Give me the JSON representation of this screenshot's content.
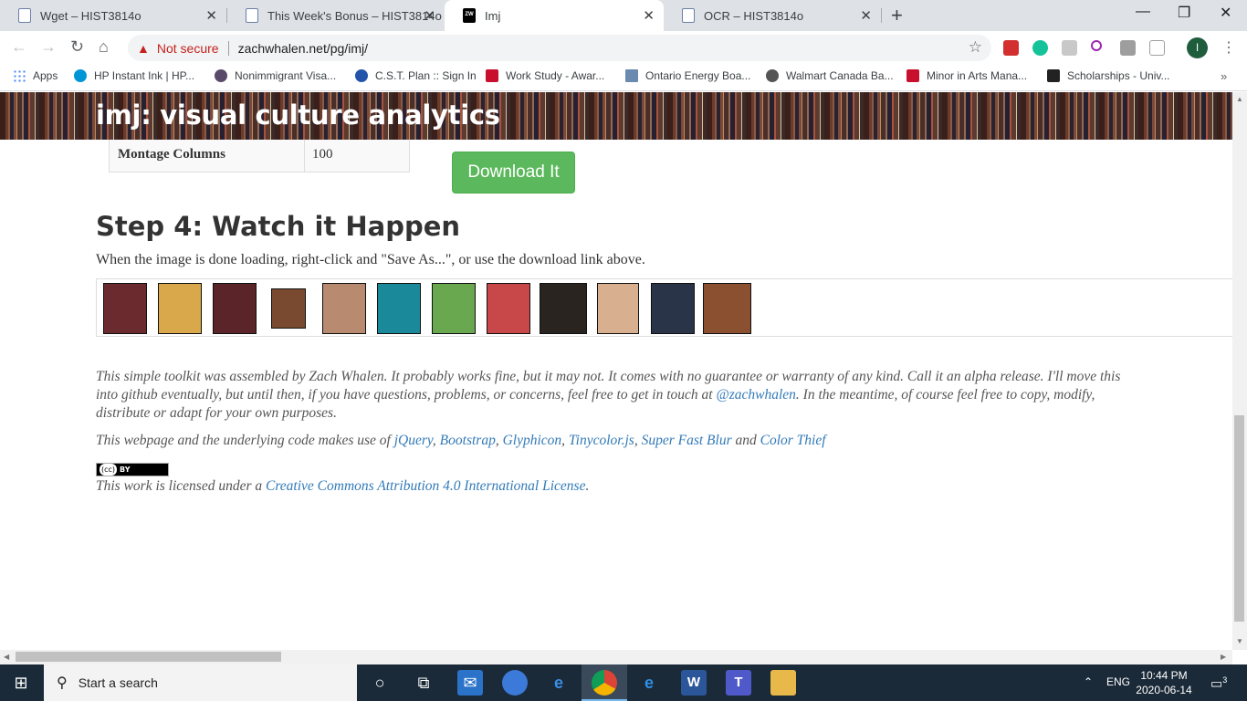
{
  "tabs": [
    {
      "title": "Wget – HIST3814o",
      "icon": "document-icon"
    },
    {
      "title": "This Week's Bonus – HIST3814o",
      "icon": "document-icon"
    },
    {
      "title": "Imj",
      "icon": "zw-favicon",
      "active": true,
      "fav_text": "ZW"
    },
    {
      "title": "OCR – HIST3814o",
      "icon": "document-icon"
    }
  ],
  "toolbar": {
    "not_secure": "Not secure",
    "url": "zachwhalen.net/pg/imj/",
    "profile_initial": "I"
  },
  "bookmarks": [
    {
      "label": "Apps",
      "color": "#4285f4"
    },
    {
      "label": "HP Instant Ink | HP...",
      "color": "#0096d6"
    },
    {
      "label": "Nonimmigrant Visa...",
      "color": "#5a4a6a"
    },
    {
      "label": "C.S.T. Plan :: Sign In",
      "color": "#2255aa"
    },
    {
      "label": "Work Study - Awar...",
      "color": "#c8102e"
    },
    {
      "label": "Ontario Energy Boa...",
      "color": "#6a8ab0"
    },
    {
      "label": "Walmart Canada Ba...",
      "color": "#555555"
    },
    {
      "label": "Minor in Arts Mana...",
      "color": "#c8102e"
    },
    {
      "label": "Scholarships - Univ...",
      "color": "#222222"
    }
  ],
  "page": {
    "banner_title": "imj: visual culture analytics",
    "table": {
      "label": "Montage Columns",
      "value": "100"
    },
    "download_button": "Download It",
    "step_heading": "Step 4: Watch it Happen",
    "step_desc": "When the image is done loading, right-click and \"Save As...\", or use the download link above.",
    "thumbnails": [
      {
        "color": "#6b2a2e"
      },
      {
        "color": "#d8a84a"
      },
      {
        "color": "#5a2428"
      },
      {
        "color": "#7a4a30"
      },
      {
        "color": "#b88a70"
      },
      {
        "color": "#1a8a9a"
      },
      {
        "color": "#6aa850"
      },
      {
        "color": "#c8484a"
      },
      {
        "color": "#2a2420"
      },
      {
        "color": "#d8b090"
      },
      {
        "color": "#2a3448"
      },
      {
        "color": "#8a5030"
      }
    ],
    "footer_p1_a": "This simple toolkit was assembled by Zach Whalen. It probably works fine, but it may not. It comes with no guarantee or warranty of any kind. Call it an alpha release. I'll move this into github eventually, but until then, if you have questions, problems, or concerns, feel free to get in touch at ",
    "footer_p1_link": "@zachwhalen",
    "footer_p1_b": ". In the meantime, of course feel free to copy, modify, distribute or adapt for your own purposes.",
    "footer_p2_a": "This webpage and the underlying code makes use of ",
    "libs": [
      "jQuery",
      "Bootstrap",
      "Glyphicon",
      "Tinycolor.js",
      "Super Fast Blur",
      "Color Thief"
    ],
    "and_word": "and",
    "cc_badge": "BY",
    "cc_logo": "(cc)",
    "license_a": "This work is licensed under a ",
    "license_link": "Creative Commons Attribution 4.0 International License",
    "license_end": "."
  },
  "taskbar": {
    "search_placeholder": "Start a search",
    "lang": "ENG",
    "time": "10:44 PM",
    "date": "2020-06-14",
    "notifications": "3"
  }
}
